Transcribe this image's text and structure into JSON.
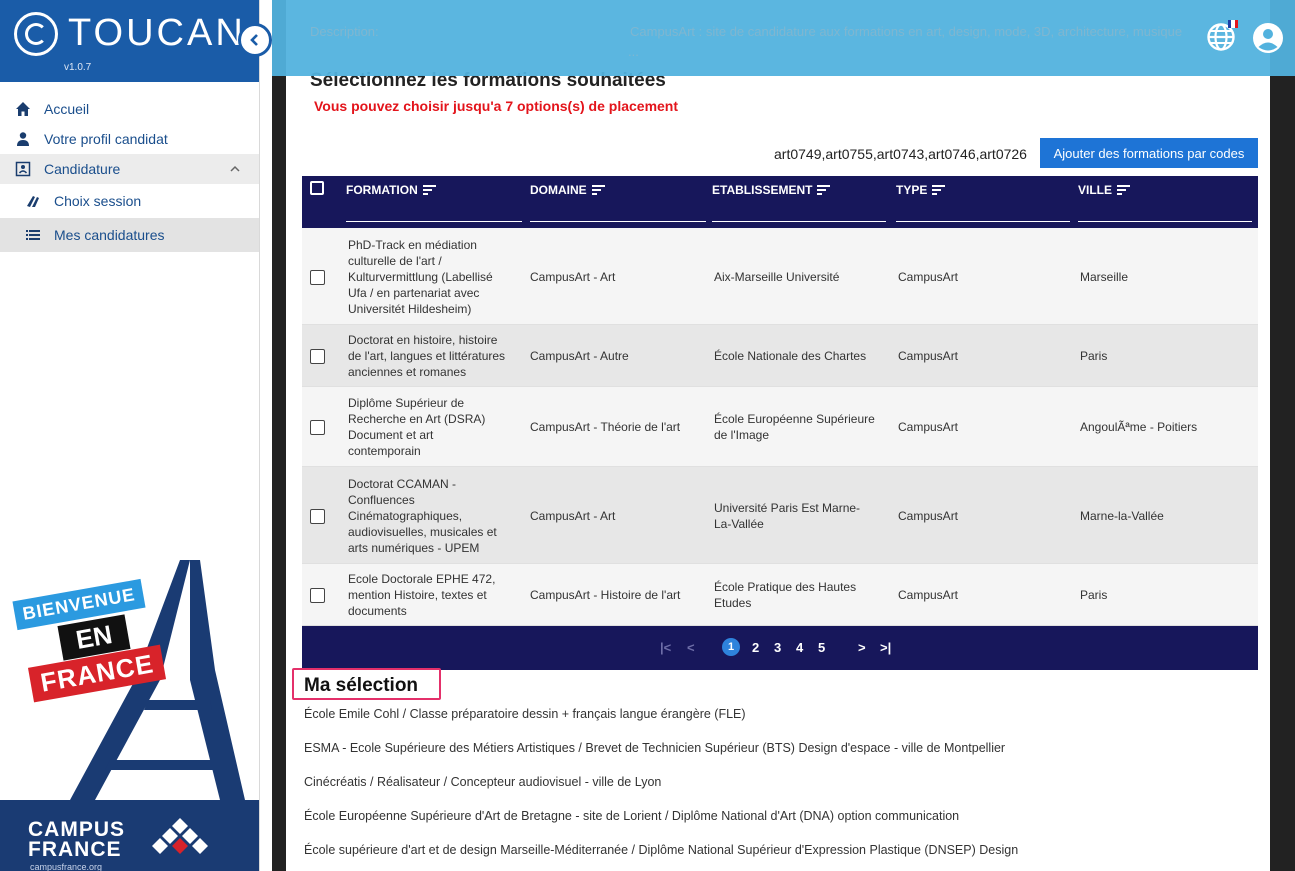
{
  "app": {
    "name": "TOUCAN",
    "version": "v1.0.7"
  },
  "sidebar": {
    "items": [
      {
        "label": "Accueil",
        "icon": "home-icon"
      },
      {
        "label": "Votre profil candidat",
        "icon": "user-icon"
      },
      {
        "label": "Candidature",
        "icon": "candidature-icon"
      },
      {
        "label": "Choix session",
        "icon": "book-icon"
      },
      {
        "label": "Mes candidatures",
        "icon": "list-icon"
      }
    ],
    "poster": {
      "bienvenue": "BIENVENUE",
      "en": "EN",
      "france": "FRANCE",
      "campus": "CAMPUS",
      "france_word": "FRANCE",
      "url": "campusfrance.org"
    }
  },
  "header": {
    "description_label": "Description:",
    "description_text": "CampusArt : site de candidature aux formations en art, design, mode, 3D, architecture, musique",
    "description_more": "..."
  },
  "main": {
    "section_title": "Sélectionnez les formations souhaitées",
    "limit_note": "Vous pouvez choisir jusqu'a 7 options(s) de placement",
    "codes_value": "art0749,art0755,art0743,art0746,art0726",
    "codes_button": "Ajouter des formations par codes"
  },
  "table": {
    "columns": [
      "FORMATION",
      "DOMAINE",
      "ETABLISSEMENT",
      "TYPE",
      "VILLE"
    ],
    "rows": [
      {
        "formation": [
          "PhD-Track en médiation",
          "culturelle de l'art /",
          "Kulturvermittlung (Labellisé",
          "Ufa / en partenariat avec",
          "Universitét Hildesheim)"
        ],
        "domaine": "CampusArt - Art",
        "etablissement": [
          "Aix-Marseille Université"
        ],
        "type": "CampusArt",
        "ville": "Marseille"
      },
      {
        "formation": [
          "Doctorat en histoire, histoire",
          "de l'art, langues et littératures",
          "anciennes et romanes"
        ],
        "domaine": "CampusArt - Autre",
        "etablissement": [
          "École Nationale des Chartes"
        ],
        "type": "CampusArt",
        "ville": "Paris"
      },
      {
        "formation": [
          "Diplôme Supérieur de",
          "Recherche en Art (DSRA)",
          "Document et art",
          "contemporain"
        ],
        "domaine": "CampusArt - Théorie de l'art",
        "etablissement": [
          "École Européenne Supérieure",
          "de l'Image"
        ],
        "type": "CampusArt",
        "ville": "AngoulÃªme - Poitiers"
      },
      {
        "formation": [
          "Doctorat CCAMAN -",
          "Confluences",
          "Cinématographiques,",
          "audiovisuelles, musicales et",
          "arts numériques - UPEM"
        ],
        "domaine": "CampusArt - Art",
        "etablissement": [
          "Université Paris Est Marne-",
          "La-Vallée"
        ],
        "type": "CampusArt",
        "ville": "Marne-la-Vallée"
      },
      {
        "formation": [
          "Ecole Doctorale EPHE 472,",
          "mention Histoire, textes et",
          "documents"
        ],
        "domaine": "CampusArt - Histoire de l'art",
        "etablissement": [
          "École Pratique des Hautes",
          "Etudes"
        ],
        "type": "CampusArt",
        "ville": "Paris"
      }
    ]
  },
  "pagination": {
    "first": "|<",
    "prev": "<",
    "pages": [
      "1",
      "2",
      "3",
      "4",
      "5"
    ],
    "current": "1",
    "next": ">",
    "last": ">|"
  },
  "selection": {
    "title": "Ma sélection",
    "items": [
      "École Emile Cohl / Classe préparatoire dessin + français langue érangère (FLE)",
      "ESMA - Ecole Supérieure des Métiers Artistiques / Brevet de Technicien Supérieur (BTS) Design d'espace - ville de Montpellier",
      "Cinécréatis / Réalisateur / Concepteur audiovisuel - ville de Lyon",
      "École Européenne Supérieure d'Art de Bretagne - site de Lorient / Diplôme National d'Art (DNA) option communication",
      "École supérieure d'art et de design Marseille-Méditerranée / Diplôme National Supérieur d'Expression Plastique (DNSEP) Design"
    ]
  },
  "colors": {
    "brand": "#1a5ca8",
    "header": "#52b2de",
    "table_header": "#17175b",
    "accent_red": "#e3141b",
    "button": "#1e74d6",
    "highlight": "#e4306a"
  }
}
